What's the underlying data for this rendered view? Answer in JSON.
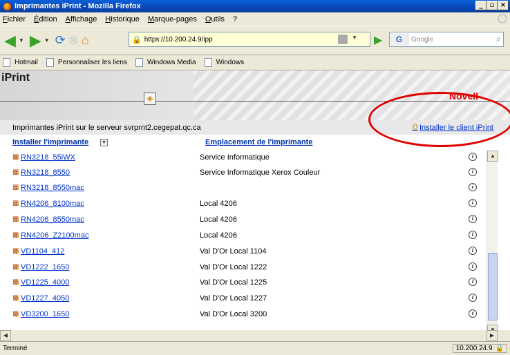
{
  "window": {
    "title": "Imprimantes iPrint - Mozilla Firefox",
    "buttons": {
      "minimize": "_",
      "maximize": "▫",
      "close": "×"
    }
  },
  "menu": [
    "Fichier",
    "Édition",
    "Affichage",
    "Historique",
    "Marque-pages",
    "Outils",
    "?"
  ],
  "navbar": {
    "url": "https://10.200.24.9/ipp",
    "search_placeholder": "Google"
  },
  "bookmarks": [
    "Hotmail",
    "Personnaliser les liens",
    "Windows Media",
    "Windows"
  ],
  "page": {
    "title": "iPrint",
    "brand": "Novell",
    "server_text": "Imprimantes iPrint sur le serveur svrprnt2.cegepat.qc.ca",
    "install_client": "Installer le client iPrint",
    "columns": {
      "install": "Installer l'imprimante",
      "location": "Emplacement de l'imprimante"
    },
    "printers": [
      {
        "name": "RN3218_55iWX",
        "location": "Service Informatique"
      },
      {
        "name": "RN3218_8550",
        "location": "Service Informatique Xerox Couleur"
      },
      {
        "name": "RN3218_8550mac",
        "location": ""
      },
      {
        "name": "RN4206_8100mac",
        "location": "Local 4206"
      },
      {
        "name": "RN4206_8550mac",
        "location": "Local 4206"
      },
      {
        "name": "RN4206_Z2100mac",
        "location": "Local 4206"
      },
      {
        "name": "VD1104_412",
        "location": "Val D'Or Local 1104"
      },
      {
        "name": "VD1222_1650",
        "location": "Val D'Or Local 1222"
      },
      {
        "name": "VD1225_4000",
        "location": "Val D'Or Local 1225"
      },
      {
        "name": "VD1227_4050",
        "location": "Val D'Or Local 1227"
      },
      {
        "name": "VD3200_1650",
        "location": "Val D'Or Local 3200"
      }
    ]
  },
  "status": {
    "text": "Terminé",
    "host": "10.200.24.9"
  }
}
